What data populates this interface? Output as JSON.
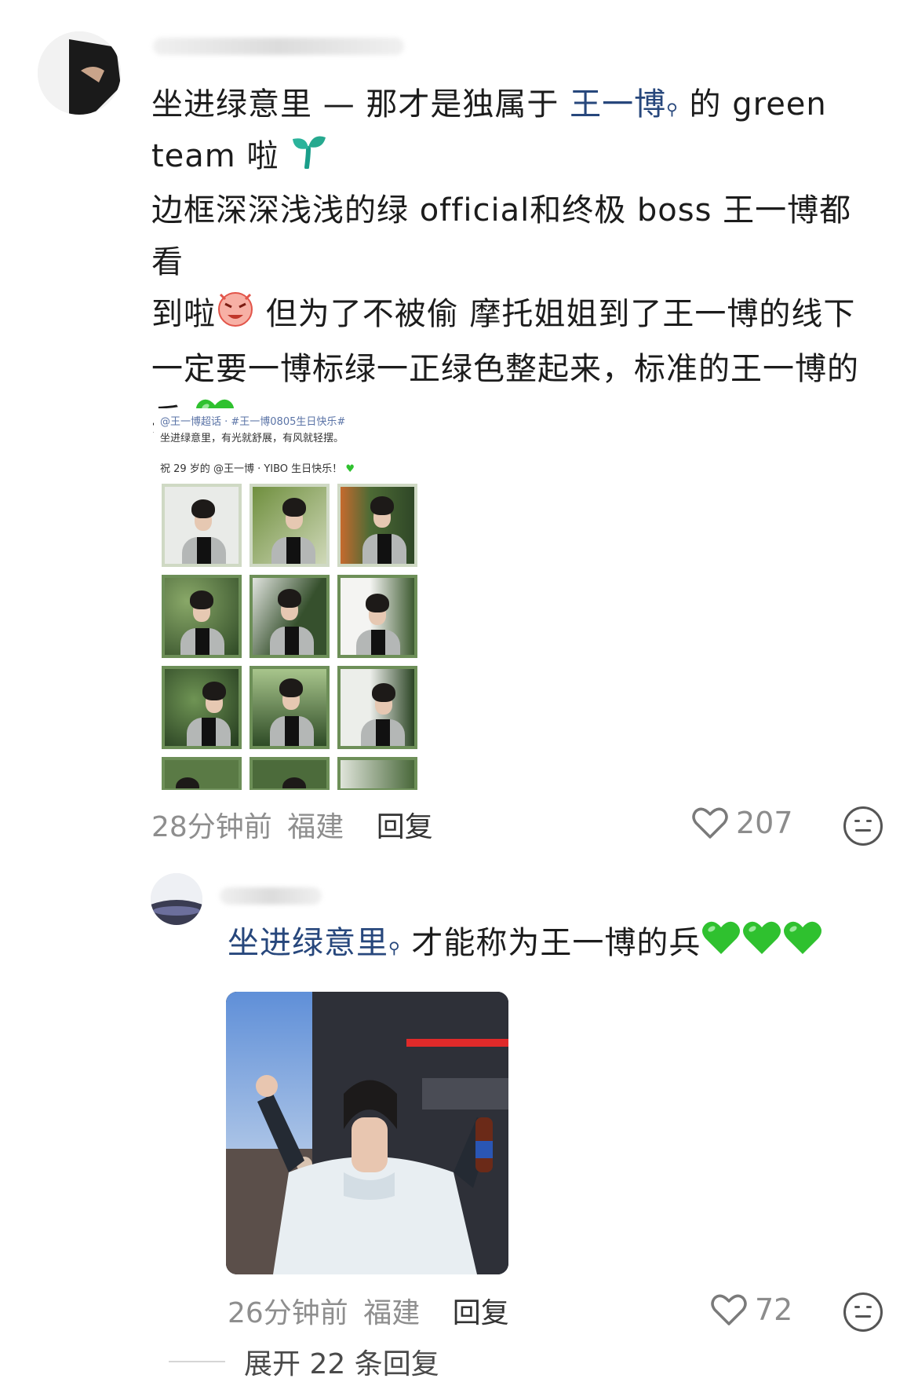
{
  "comment": {
    "avatar_desc": "user-avatar",
    "username": "",
    "text_lines": [
      [
        "坐进绿意里 — 那才是独属于 ",
        "王一博",
        " 的 green"
      ],
      [
        "team 啦"
      ],
      [
        "边框深深浅浅的绿 official和终极 boss 王一博都看"
      ],
      [
        "到啦",
        " 但为了不被偷 摩托姐姐到了王一博的线下"
      ],
      [
        "一定要一博标绿一正绿色整起来，标准的王一博的"
      ],
      [
        "兵"
      ]
    ],
    "post_screenshot": {
      "line1_tag": "@王一博超话 · #王一博0805生日快乐#",
      "line2": "坐进绿意里，有光就舒展，有风就轻摆。",
      "line3": "祝 29 岁的 @王一博 · YIBO 生日快乐！"
    },
    "time": "28分钟前",
    "location": "福建",
    "reply_label": "回复",
    "likes": "207"
  },
  "reply": {
    "username": "",
    "mention": "坐进绿意里",
    "text": "才能称为王一博的兵",
    "time": "26分钟前",
    "location": "福建",
    "reply_label": "回复",
    "likes": "72"
  },
  "expand": {
    "label": "展开 22 条回复"
  },
  "colors": {
    "mention": "#27477c",
    "meta": "#8e8e8e",
    "heart_green": "#2fc12f"
  },
  "icons": [
    "heart-outline-icon",
    "neutral-face-icon",
    "search-mark-icon",
    "sprout-emoji-icon",
    "angry-face-emoji-icon",
    "green-heart-emoji-icon"
  ]
}
